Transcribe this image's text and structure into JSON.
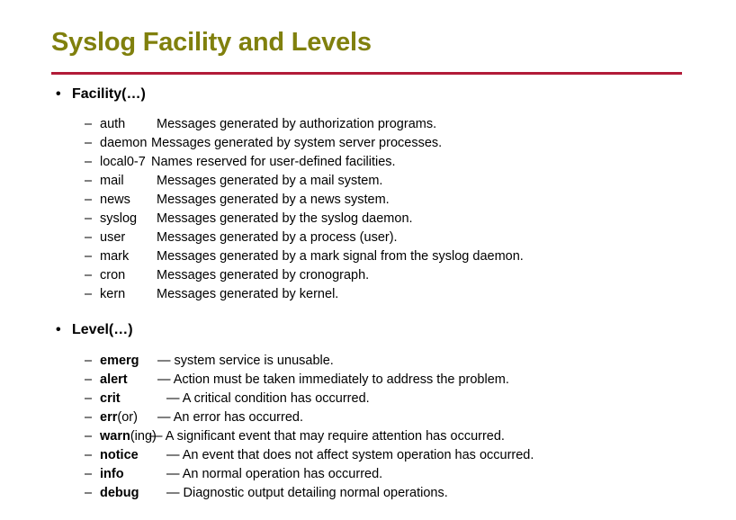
{
  "slide": {
    "title": "Syslog Facility and Levels",
    "accent_color": "#80800d",
    "rule_color": "#b21b38",
    "background_color": "#ffffff",
    "text_color": "#000000"
  },
  "bullets": {
    "facility_heading": "Facility(…)",
    "level_heading": "Level(…)",
    "marker": "•",
    "sub_marker": "–"
  },
  "facility": {
    "items": [
      {
        "term": "auth",
        "desc": "Messages generated by authorization programs."
      },
      {
        "term": "daemon",
        "desc": "Messages generated by system server processes."
      },
      {
        "term": "local0-7",
        "desc": "Names reserved for user-defined facilities."
      },
      {
        "term": "mail",
        "desc": "Messages generated by a mail system."
      },
      {
        "term": "news",
        "desc": "Messages generated by a news system."
      },
      {
        "term": "syslog",
        "desc": "Messages generated by the syslog daemon."
      },
      {
        "term": "user",
        "desc": "Messages generated by a process (user)."
      },
      {
        "term": "mark",
        "desc": "Messages generated by a mark signal from the syslog daemon."
      },
      {
        "term": "cron",
        "desc": "Messages generated by cronograph."
      },
      {
        "term": "kern",
        "desc": "Messages generated by kernel."
      }
    ]
  },
  "level": {
    "items": [
      {
        "term": "emerg",
        "suffix": "",
        "desc": "— system service is unusable."
      },
      {
        "term": "alert",
        "suffix": "",
        "desc": "— Action must be taken immediately to address the problem."
      },
      {
        "term": "crit",
        "suffix": "",
        "desc": "— A critical condition has occurred."
      },
      {
        "term": "err",
        "suffix": "(or)",
        "desc": "— An error has occurred."
      },
      {
        "term": "warn",
        "suffix": "(ing)",
        "desc": "— A significant event that may require attention has occurred."
      },
      {
        "term": "notice",
        "suffix": "",
        "desc": "— An event that does not affect system operation has occurred."
      },
      {
        "term": "info",
        "suffix": "",
        "desc": "— An normal operation has occurred."
      },
      {
        "term": "debug",
        "suffix": "",
        "desc": "— Diagnostic output detailing normal operations."
      }
    ]
  }
}
